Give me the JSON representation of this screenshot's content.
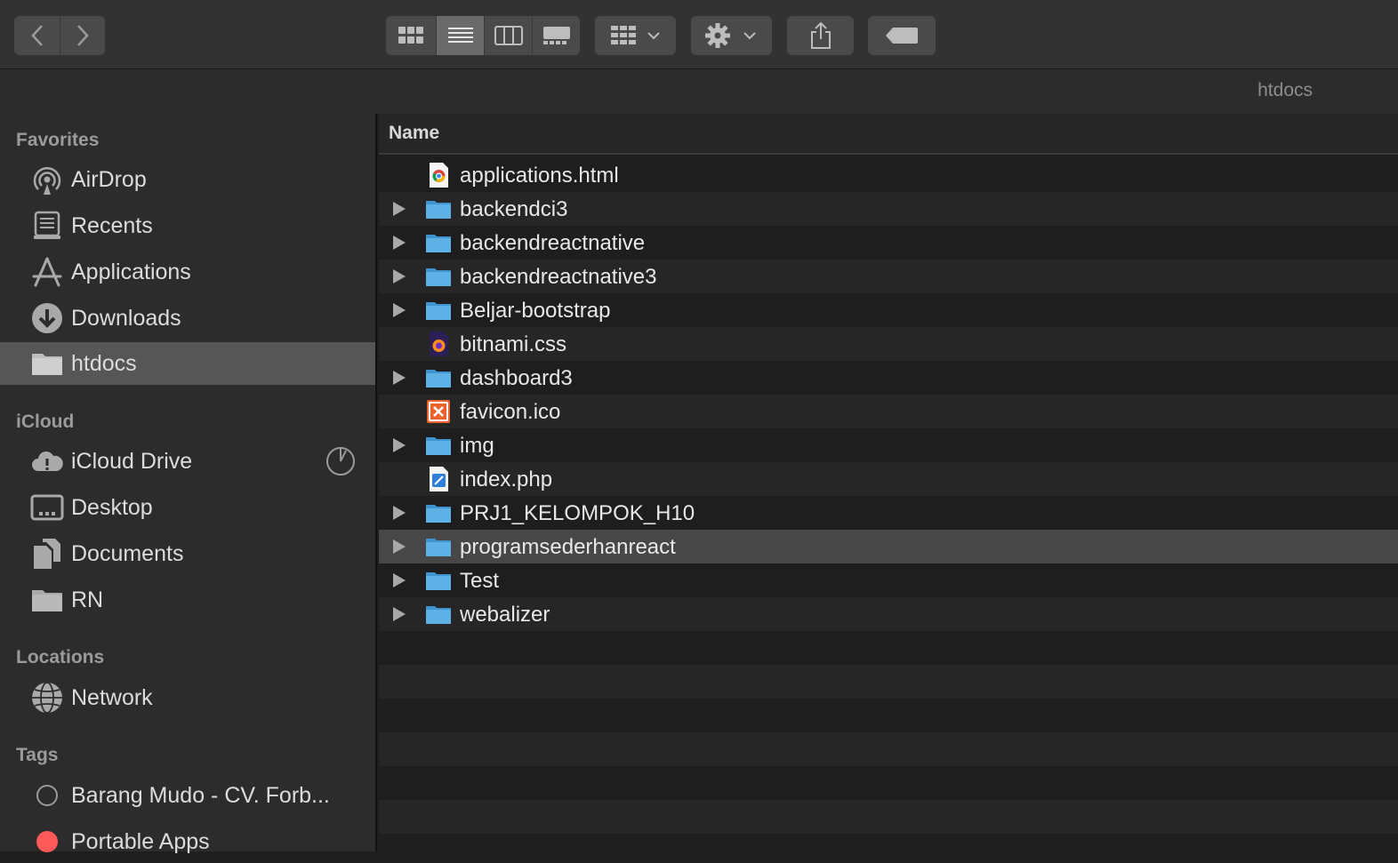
{
  "window": {
    "path_title": "htdocs"
  },
  "toolbar": {
    "back": "chevron-left-icon",
    "forward": "chevron-right-icon",
    "views": [
      "icon-view",
      "list-view",
      "column-view",
      "gallery-view"
    ],
    "active_view": "list-view",
    "group": "group-icon",
    "action": "gear-icon",
    "share": "share-icon",
    "tag": "tag-icon"
  },
  "sidebar": {
    "favorites_heading": "Favorites",
    "favorites": [
      {
        "label": "AirDrop",
        "icon": "airdrop-icon"
      },
      {
        "label": "Recents",
        "icon": "recents-icon"
      },
      {
        "label": "Applications",
        "icon": "applications-icon"
      },
      {
        "label": "Downloads",
        "icon": "downloads-icon"
      },
      {
        "label": "htdocs",
        "icon": "folder-icon",
        "selected": true
      }
    ],
    "icloud_heading": "iCloud",
    "icloud": [
      {
        "label": "iCloud Drive",
        "icon": "icloud-icon"
      },
      {
        "label": "Desktop",
        "icon": "desktop-icon"
      },
      {
        "label": "Documents",
        "icon": "documents-icon"
      },
      {
        "label": "RN",
        "icon": "folder-icon"
      }
    ],
    "locations_heading": "Locations",
    "locations": [
      {
        "label": "Network",
        "icon": "network-icon"
      }
    ],
    "tags_heading": "Tags",
    "tags": [
      {
        "label": "Barang Mudo - CV. Forb...",
        "color": "#2c2c2c"
      },
      {
        "label": "Portable Apps",
        "color": "#ff5a5a"
      }
    ]
  },
  "list": {
    "column_name": "Name",
    "rows": [
      {
        "name": "applications.html",
        "kind": "html",
        "expandable": false
      },
      {
        "name": "backendci3",
        "kind": "folder",
        "expandable": true
      },
      {
        "name": "backendreactnative",
        "kind": "folder",
        "expandable": true
      },
      {
        "name": "backendreactnative3",
        "kind": "folder",
        "expandable": true
      },
      {
        "name": "Beljar-bootstrap",
        "kind": "folder",
        "expandable": true
      },
      {
        "name": "bitnami.css",
        "kind": "css",
        "expandable": false
      },
      {
        "name": "dashboard3",
        "kind": "folder",
        "expandable": true
      },
      {
        "name": "favicon.ico",
        "kind": "ico",
        "expandable": false
      },
      {
        "name": "img",
        "kind": "folder",
        "expandable": true
      },
      {
        "name": "index.php",
        "kind": "php",
        "expandable": false
      },
      {
        "name": "PRJ1_KELOMPOK_H10",
        "kind": "folder",
        "expandable": true
      },
      {
        "name": "programsederhanreact",
        "kind": "folder",
        "expandable": true,
        "selected": true
      },
      {
        "name": "Test",
        "kind": "folder",
        "expandable": true
      },
      {
        "name": "webalizer",
        "kind": "folder",
        "expandable": true
      }
    ]
  },
  "colors": {
    "folder": "#5eb1e6",
    "selection": "#474747",
    "sidebar_selection": "#565656"
  }
}
